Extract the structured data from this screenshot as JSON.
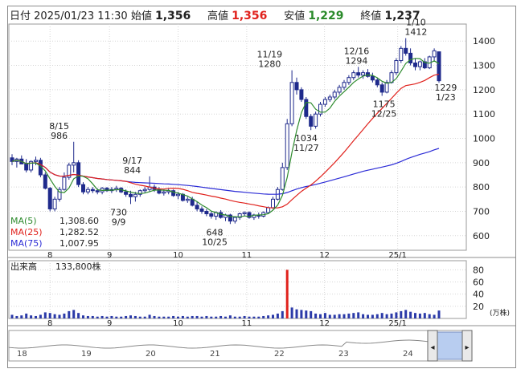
{
  "header": {
    "date_label": "日付",
    "date_value": "2025/01/23 11:30",
    "open_label": "始値",
    "open_value": "1,356",
    "high_label": "高値",
    "high_value": "1,356",
    "low_label": "安値",
    "low_value": "1,229",
    "close_label": "終値",
    "close_value": "1,237"
  },
  "legend": {
    "ma5_label": "MA(5)",
    "ma5_value": "1,308.60",
    "ma25_label": "MA(25)",
    "ma25_value": "1,282.52",
    "ma75_label": "MA(75)",
    "ma75_value": "1,007.95"
  },
  "volume_panel": {
    "label": "出来高",
    "value": "133,800株",
    "unit": "(万株)"
  },
  "colors": {
    "ma5": "#2e8b2e",
    "ma25": "#e0211c",
    "ma75": "#2b2bd6",
    "candle": "#1f2a8c",
    "volume": "#2b3aa8",
    "volume_spike": "#e0211c",
    "header_red": "#e0211c",
    "header_green": "#2a8a2a"
  },
  "chart_data": {
    "type": "candlestick",
    "y_axis": {
      "ticks": [
        600,
        700,
        800,
        900,
        1000,
        1100,
        1200,
        1300,
        1400
      ],
      "range": [
        540,
        1470
      ]
    },
    "x_axis": {
      "month_ticks": [
        {
          "label": "8",
          "t": 0.09
        },
        {
          "label": "9",
          "t": 0.22
        },
        {
          "label": "10",
          "t": 0.37
        },
        {
          "label": "11",
          "t": 0.52
        },
        {
          "label": "12",
          "t": 0.69
        },
        {
          "label": "25/1",
          "t": 0.85
        }
      ]
    },
    "annotations": [
      {
        "lines": [
          "8/15",
          "986"
        ],
        "t": 0.11,
        "price": 986,
        "side": "above"
      },
      {
        "lines": [
          "9/17",
          "844"
        ],
        "t": 0.27,
        "price": 844,
        "side": "above"
      },
      {
        "lines": [
          "730",
          "9/9"
        ],
        "t": 0.24,
        "price": 730,
        "side": "below"
      },
      {
        "lines": [
          "648",
          "10/25"
        ],
        "t": 0.45,
        "price": 648,
        "side": "below"
      },
      {
        "lines": [
          "11/19",
          "1280"
        ],
        "t": 0.57,
        "price": 1280,
        "side": "above"
      },
      {
        "lines": [
          "1034",
          "11/27"
        ],
        "t": 0.65,
        "price": 1034,
        "side": "below"
      },
      {
        "lines": [
          "12/16",
          "1294"
        ],
        "t": 0.76,
        "price": 1294,
        "side": "above"
      },
      {
        "lines": [
          "1175",
          "12/25"
        ],
        "t": 0.82,
        "price": 1175,
        "side": "below"
      },
      {
        "lines": [
          "1/10",
          "1412"
        ],
        "t": 0.89,
        "price": 1412,
        "side": "above"
      },
      {
        "lines": [
          "1229",
          "1/23"
        ],
        "t": 0.955,
        "price": 1229,
        "side": "right"
      }
    ],
    "candles": [
      [
        920,
        935,
        890,
        905
      ],
      [
        905,
        920,
        880,
        915
      ],
      [
        915,
        930,
        900,
        895
      ],
      [
        895,
        915,
        860,
        870
      ],
      [
        870,
        910,
        860,
        905
      ],
      [
        905,
        925,
        890,
        910
      ],
      [
        910,
        920,
        840,
        850
      ],
      [
        850,
        860,
        790,
        795
      ],
      [
        795,
        800,
        700,
        710
      ],
      [
        710,
        760,
        700,
        750
      ],
      [
        750,
        800,
        740,
        790
      ],
      [
        790,
        860,
        785,
        840
      ],
      [
        840,
        900,
        830,
        890
      ],
      [
        890,
        986,
        860,
        900
      ],
      [
        900,
        910,
        800,
        810
      ],
      [
        810,
        820,
        770,
        780
      ],
      [
        780,
        800,
        770,
        790
      ],
      [
        790,
        800,
        775,
        785
      ],
      [
        785,
        795,
        770,
        780
      ],
      [
        780,
        800,
        770,
        795
      ],
      [
        795,
        800,
        780,
        785
      ],
      [
        785,
        800,
        775,
        790
      ],
      [
        790,
        805,
        780,
        795
      ],
      [
        795,
        800,
        775,
        780
      ],
      [
        780,
        790,
        760,
        770
      ],
      [
        770,
        785,
        730,
        760
      ],
      [
        760,
        780,
        740,
        770
      ],
      [
        770,
        790,
        760,
        785
      ],
      [
        785,
        800,
        775,
        790
      ],
      [
        790,
        844,
        780,
        800
      ],
      [
        800,
        810,
        780,
        790
      ],
      [
        790,
        800,
        770,
        775
      ],
      [
        775,
        790,
        765,
        780
      ],
      [
        780,
        795,
        770,
        785
      ],
      [
        785,
        790,
        760,
        765
      ],
      [
        765,
        780,
        750,
        770
      ],
      [
        770,
        775,
        740,
        745
      ],
      [
        745,
        760,
        735,
        750
      ],
      [
        750,
        760,
        720,
        725
      ],
      [
        725,
        740,
        700,
        710
      ],
      [
        710,
        720,
        690,
        700
      ],
      [
        700,
        710,
        680,
        690
      ],
      [
        690,
        700,
        670,
        680
      ],
      [
        680,
        700,
        665,
        695
      ],
      [
        695,
        705,
        670,
        675
      ],
      [
        675,
        690,
        660,
        685
      ],
      [
        685,
        690,
        648,
        660
      ],
      [
        660,
        680,
        650,
        675
      ],
      [
        675,
        695,
        665,
        690
      ],
      [
        690,
        700,
        680,
        695
      ],
      [
        695,
        700,
        670,
        675
      ],
      [
        675,
        690,
        665,
        685
      ],
      [
        685,
        695,
        670,
        680
      ],
      [
        680,
        700,
        675,
        695
      ],
      [
        695,
        720,
        690,
        715
      ],
      [
        715,
        760,
        710,
        750
      ],
      [
        750,
        800,
        745,
        790
      ],
      [
        790,
        900,
        785,
        880
      ],
      [
        880,
        1080,
        870,
        1060
      ],
      [
        1060,
        1280,
        1050,
        1230
      ],
      [
        1230,
        1250,
        1180,
        1200
      ],
      [
        1200,
        1210,
        1150,
        1160
      ],
      [
        1160,
        1170,
        1080,
        1090
      ],
      [
        1090,
        1100,
        1034,
        1050
      ],
      [
        1050,
        1110,
        1040,
        1100
      ],
      [
        1100,
        1150,
        1090,
        1140
      ],
      [
        1140,
        1170,
        1130,
        1160
      ],
      [
        1160,
        1180,
        1150,
        1170
      ],
      [
        1170,
        1200,
        1160,
        1190
      ],
      [
        1190,
        1220,
        1180,
        1210
      ],
      [
        1210,
        1240,
        1200,
        1230
      ],
      [
        1230,
        1260,
        1220,
        1250
      ],
      [
        1250,
        1280,
        1240,
        1270
      ],
      [
        1270,
        1294,
        1250,
        1260
      ],
      [
        1260,
        1280,
        1245,
        1270
      ],
      [
        1270,
        1285,
        1250,
        1255
      ],
      [
        1255,
        1270,
        1230,
        1240
      ],
      [
        1240,
        1250,
        1210,
        1220
      ],
      [
        1220,
        1230,
        1175,
        1190
      ],
      [
        1190,
        1240,
        1185,
        1230
      ],
      [
        1230,
        1280,
        1225,
        1270
      ],
      [
        1270,
        1330,
        1260,
        1320
      ],
      [
        1320,
        1380,
        1310,
        1370
      ],
      [
        1370,
        1412,
        1340,
        1350
      ],
      [
        1350,
        1370,
        1300,
        1310
      ],
      [
        1310,
        1330,
        1280,
        1295
      ],
      [
        1295,
        1320,
        1280,
        1315
      ],
      [
        1315,
        1330,
        1285,
        1290
      ],
      [
        1290,
        1340,
        1285,
        1335
      ],
      [
        1335,
        1370,
        1320,
        1360
      ],
      [
        1356,
        1356,
        1229,
        1237
      ]
    ],
    "volume": {
      "ticks": [
        20,
        40,
        60,
        80
      ],
      "range": [
        0,
        95
      ],
      "values": [
        6,
        4,
        5,
        8,
        5,
        4,
        6,
        10,
        9,
        7,
        6,
        8,
        12,
        14,
        9,
        5,
        4,
        4,
        3,
        4,
        3,
        4,
        3,
        3,
        4,
        5,
        4,
        3,
        3,
        6,
        4,
        3,
        3,
        3,
        4,
        3,
        4,
        3,
        4,
        4,
        3,
        4,
        3,
        3,
        4,
        3,
        5,
        3,
        3,
        4,
        3,
        3,
        3,
        4,
        5,
        6,
        8,
        12,
        80,
        18,
        15,
        14,
        13,
        12,
        8,
        7,
        9,
        6,
        6,
        7,
        7,
        8,
        9,
        10,
        7,
        6,
        6,
        7,
        9,
        7,
        8,
        10,
        12,
        14,
        11,
        9,
        8,
        9,
        7,
        6,
        13
      ]
    },
    "navigator": {
      "labels": [
        "18",
        "19",
        "20",
        "21",
        "22",
        "23",
        "24"
      ]
    }
  }
}
